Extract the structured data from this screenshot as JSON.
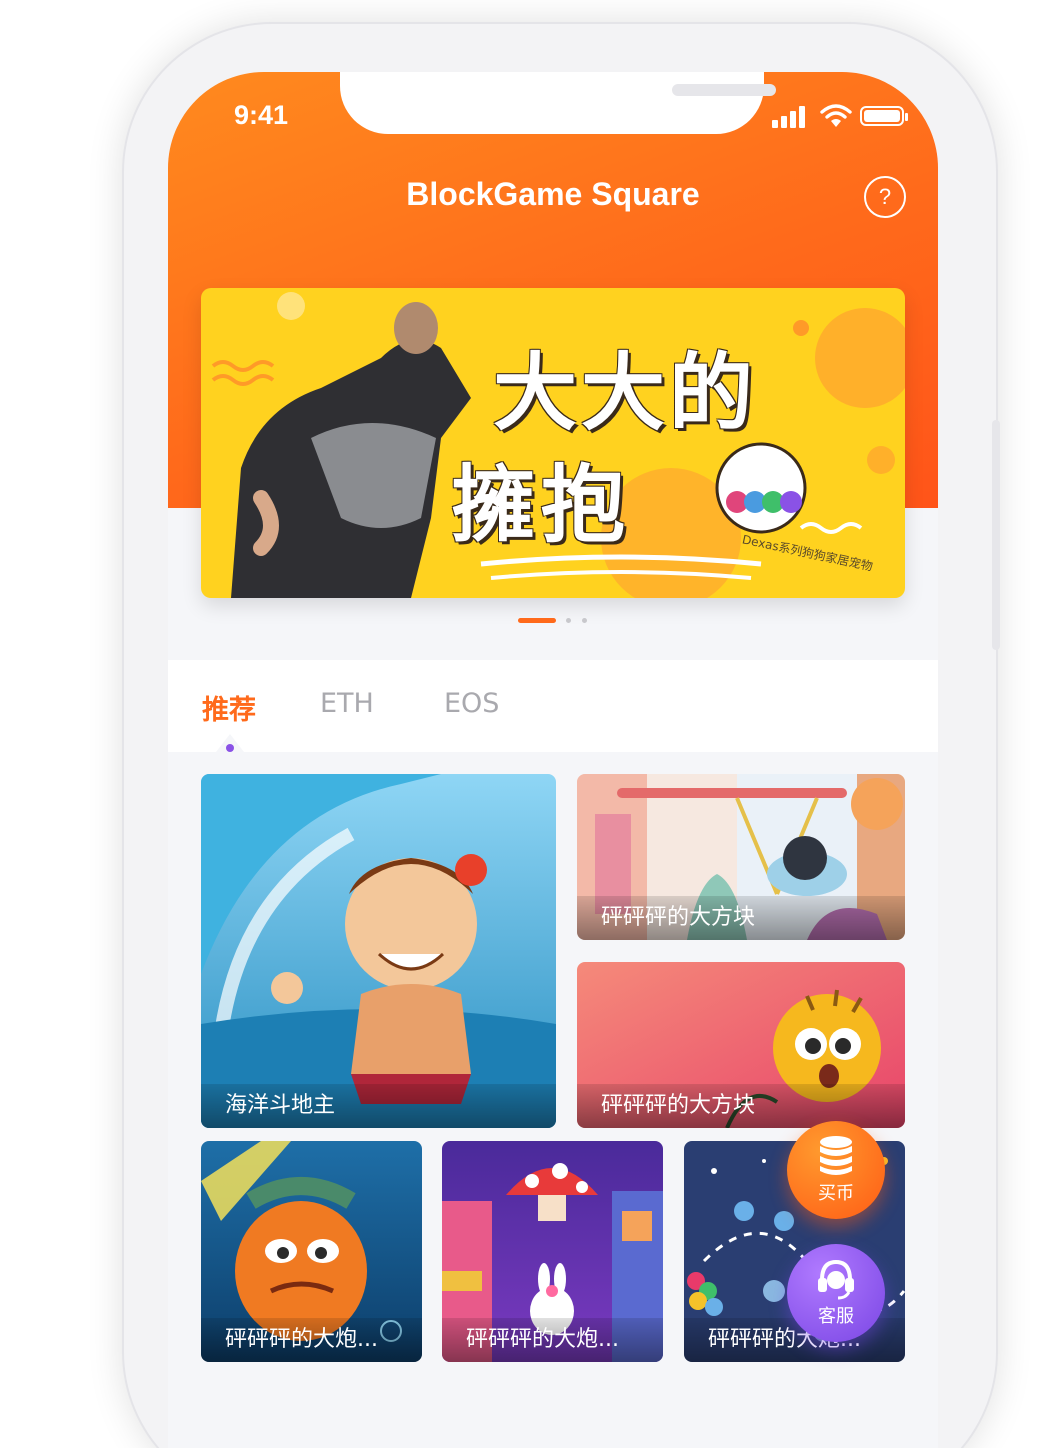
{
  "status_bar": {
    "time": "9:41"
  },
  "header": {
    "title": "BlockGame Square",
    "help_label": "?"
  },
  "banner": {
    "title_line1": "大大的",
    "title_line2": "擁抱",
    "caption": "Dexas系列狗狗家居宠物",
    "pager": {
      "count": 3,
      "active_index": 0
    }
  },
  "tabs": [
    {
      "label": "推荐",
      "active": true
    },
    {
      "label": "ETH",
      "active": false
    },
    {
      "label": "EOS",
      "active": false
    }
  ],
  "games": [
    {
      "title": "海洋斗地主"
    },
    {
      "title": "砰砰砰的大方块"
    },
    {
      "title": "砰砰砰的大方块"
    },
    {
      "title": "砰砰砰的大炮..."
    },
    {
      "title": "砰砰砰的大炮..."
    },
    {
      "title": "砰砰砰的大炮..."
    }
  ],
  "floating_buttons": {
    "buy_label": "买币",
    "service_label": "客服"
  },
  "colors": {
    "accent": "#ff6a1b",
    "indicator": "#8a52e6",
    "service": "#7a46e4"
  }
}
